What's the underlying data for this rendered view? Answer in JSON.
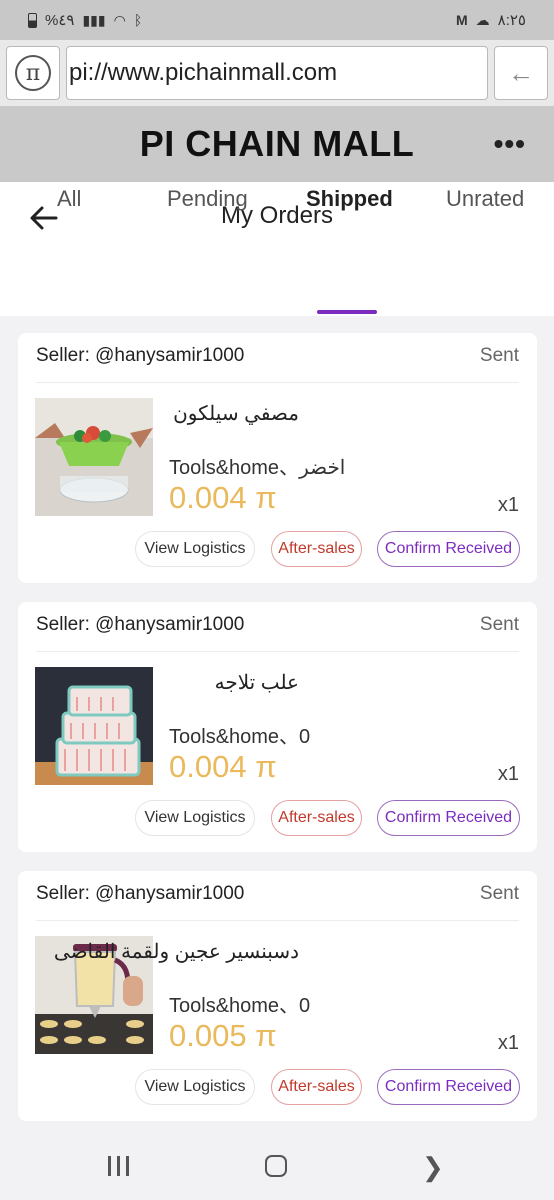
{
  "status_bar": {
    "left": "%٤٩",
    "time": "٨:٢٥"
  },
  "browser": {
    "url": "pi://www.pichainmall.com"
  },
  "mall": {
    "title": "PI CHAIN MALL",
    "more_icon": "more-dots-icon"
  },
  "page": {
    "title": "My Orders",
    "tabs": [
      {
        "label": "All",
        "active": false
      },
      {
        "label": "Pending",
        "active": false
      },
      {
        "label": "Shipped",
        "active": true
      },
      {
        "label": "Unrated",
        "active": false
      }
    ]
  },
  "orders": [
    {
      "seller": "Seller: @hanysamir1000",
      "status": "Sent",
      "product_name": "مصفي سيلكون",
      "variant": "Tools&home、اخضر",
      "price": "0.004 π",
      "qty": "x1",
      "buttons": {
        "logistics": "View Logistics",
        "aftersales": "After-sales",
        "confirm": "Confirm Received"
      }
    },
    {
      "seller": "Seller: @hanysamir1000",
      "status": "Sent",
      "product_name": "علب تلاجه",
      "variant": "Tools&home、0",
      "price": "0.004 π",
      "qty": "x1",
      "buttons": {
        "logistics": "View Logistics",
        "aftersales": "After-sales",
        "confirm": "Confirm Received"
      }
    },
    {
      "seller": "Seller: @hanysamir1000",
      "status": "Sent",
      "product_name": "دسبنسير عجين ولقمة القاضى",
      "variant": "Tools&home、0",
      "price": "0.005 π",
      "qty": "x1",
      "buttons": {
        "logistics": "View Logistics",
        "aftersales": "After-sales",
        "confirm": "Confirm Received"
      }
    }
  ],
  "colors": {
    "accent": "#7b2cbf",
    "price": "#e9b95c",
    "aftersales": "#c0392b"
  }
}
